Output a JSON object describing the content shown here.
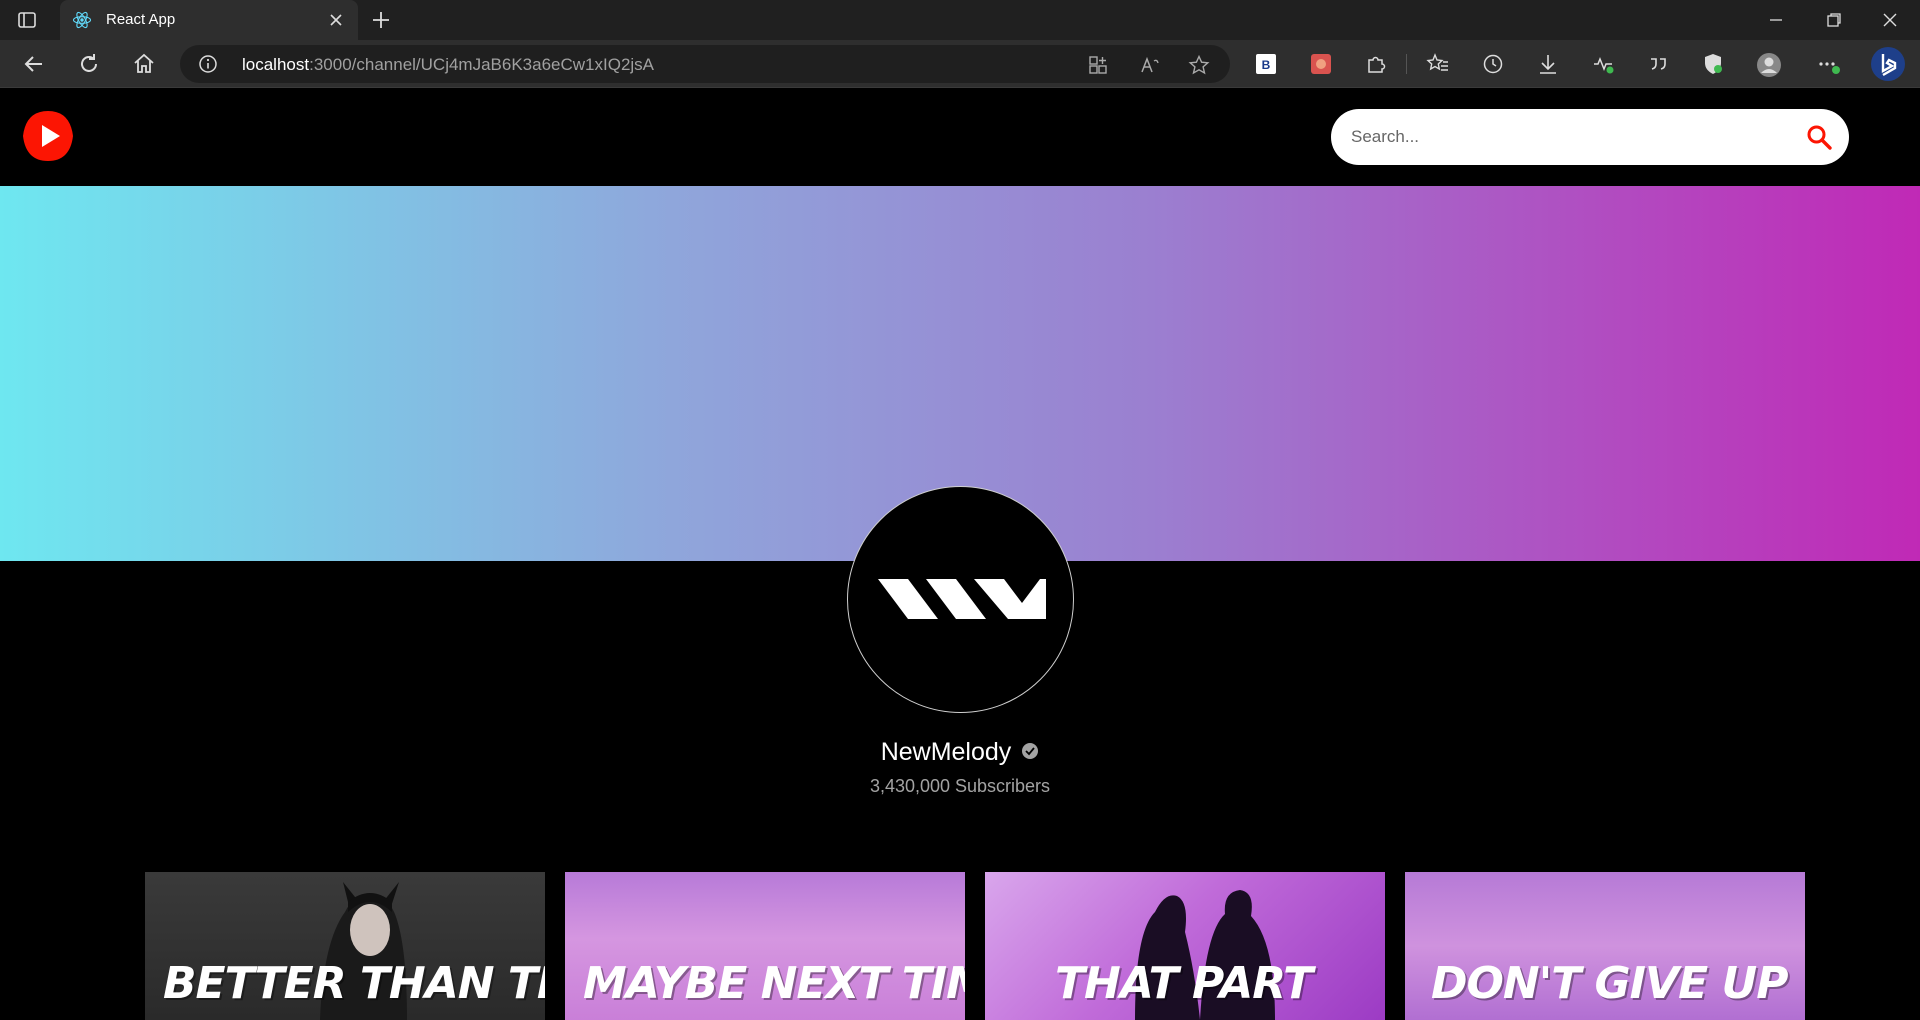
{
  "browser": {
    "tab_title": "React App",
    "address_host": "localhost",
    "address_path": ":3000/channel/UCj4mJaB6K3a6eCw1xIQ2jsA"
  },
  "header": {
    "search_placeholder": "Search..."
  },
  "channel": {
    "name": "NewMelody",
    "subscribers": "3,430,000 Subscribers"
  },
  "videos": [
    {
      "title": "BETTER THAN THE BOY"
    },
    {
      "title": "MAYBE NEXT TIM"
    },
    {
      "title": "THAT PART"
    },
    {
      "title": "DON'T GIVE UP"
    }
  ],
  "colors": {
    "accent": "#fc1503",
    "banner_start": "#6ee7f0",
    "banner_end": "#c029b6"
  }
}
